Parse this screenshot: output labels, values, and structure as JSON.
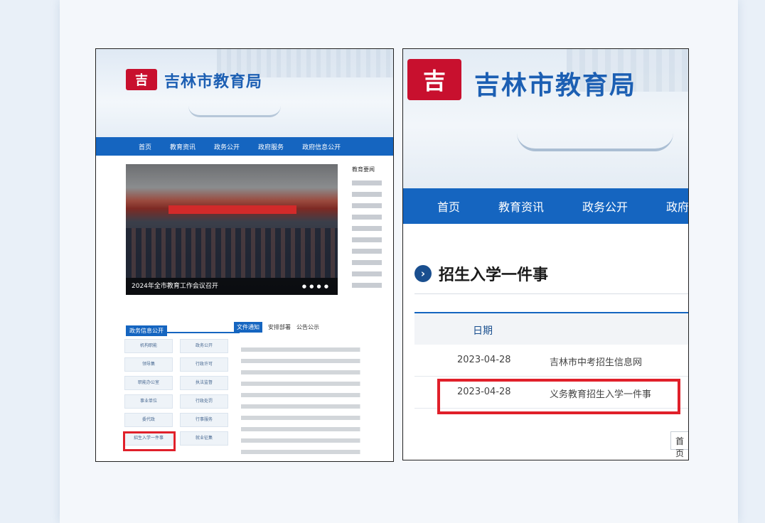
{
  "heading": "",
  "left_site": {
    "logo_glyph": "吉",
    "title": "吉林市教育局",
    "nav": [
      "首页",
      "教育资讯",
      "政务公开",
      "政府服务",
      "政府信息公开"
    ],
    "photo_caption": "2024年全市教育工作会议召开",
    "side_tab": "教育要闻",
    "gov_panel_title": "政务信息公开",
    "gov_items": [
      "机构职能",
      "政务公开",
      "领导集",
      "行政许可",
      "职能办公室",
      "执法监督",
      "事业单位",
      "行政处罚",
      "委代政",
      "行事服务",
      "招生入学一件事",
      "就业征集"
    ],
    "doc_tabs": [
      "文件通知",
      "安排部署",
      "公告公示"
    ]
  },
  "right_site": {
    "logo_glyph": "吉",
    "title": "吉林市教育局",
    "nav": [
      "首页",
      "教育资讯",
      "政务公开",
      "政府"
    ],
    "section_title": "招生入学一件事",
    "table_header_date": "日期",
    "rows": [
      {
        "date": "2023-04-28",
        "title": "吉林市中考招生信息网"
      },
      {
        "date": "2023-04-28",
        "title": "义务教育招生入学一件事"
      }
    ],
    "pager_first": "首页"
  },
  "colors": {
    "brand_blue": "#1565c0",
    "title_blue": "#1c5fb3",
    "logo_red": "#c8102e",
    "highlight_red": "#e0202a"
  }
}
